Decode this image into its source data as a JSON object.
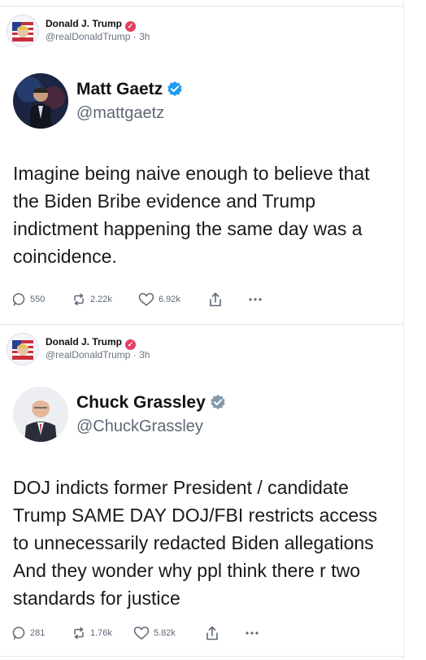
{
  "posts": [
    {
      "poster": {
        "name": "Donald J. Trump",
        "handle_time": "@realDonaldTrump · 3h"
      },
      "embed": {
        "name": "Matt Gaetz",
        "handle": "@mattgaetz",
        "verified_color": "#1d9bf0"
      },
      "text": "Imagine being naive enough to believe that the Biden Bribe evidence and Trump indictment happening the same day was a coincidence.",
      "actions": {
        "replies": "550",
        "reposts": "2.22k",
        "likes": "6.92k"
      }
    },
    {
      "poster": {
        "name": "Donald J. Trump",
        "handle_time": "@realDonaldTrump · 3h"
      },
      "embed": {
        "name": "Chuck Grassley",
        "handle": "@ChuckGrassley",
        "verified_color": "#829aab"
      },
      "text": "DOJ indicts former President / candidate Trump SAME DAY DOJ/FBI restricts access to unnecessarily redacted Biden allegations And they wonder why ppl think there r two standards for justice",
      "actions": {
        "replies": "281",
        "reposts": "1.76k",
        "likes": "5.82k"
      }
    }
  ],
  "colors": {
    "accent_pink": "#e4405f",
    "muted": "#5f6876"
  }
}
